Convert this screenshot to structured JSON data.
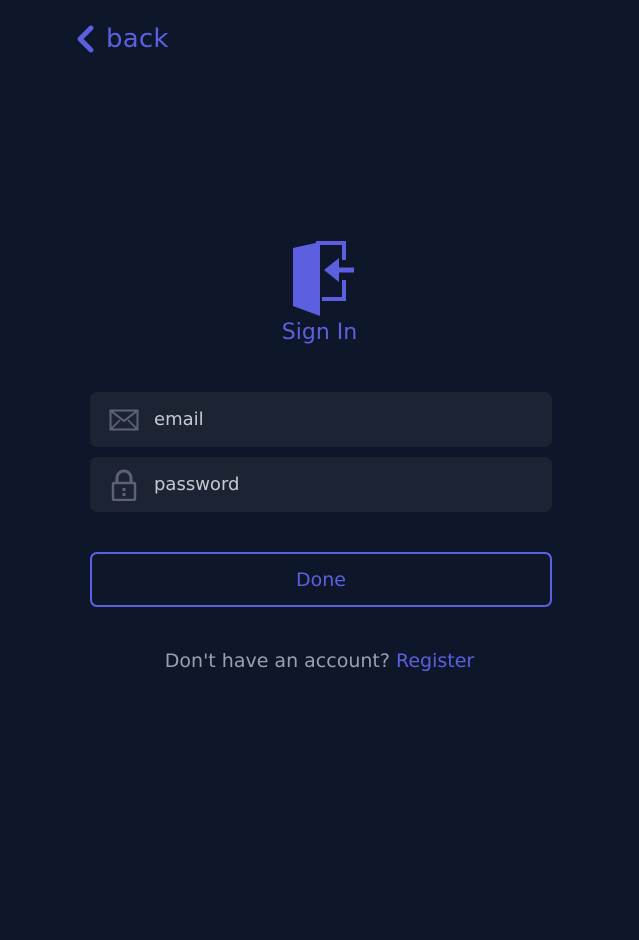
{
  "nav": {
    "back_label": "back",
    "back_icon": "chevron-left-icon"
  },
  "header": {
    "logo_icon": "sign-in-door-icon",
    "title": "Sign In"
  },
  "form": {
    "email": {
      "icon": "envelope-icon",
      "placeholder": "email",
      "value": ""
    },
    "password": {
      "icon": "lock-icon",
      "placeholder": "password",
      "value": ""
    },
    "submit_label": "Done"
  },
  "footer": {
    "prompt": "Don't have an account?",
    "register_label": "Register"
  },
  "colors": {
    "background": "#0e1729",
    "accent": "#5b5fe0",
    "field_background": "#1c2333",
    "muted_text": "#9aa0ab"
  }
}
